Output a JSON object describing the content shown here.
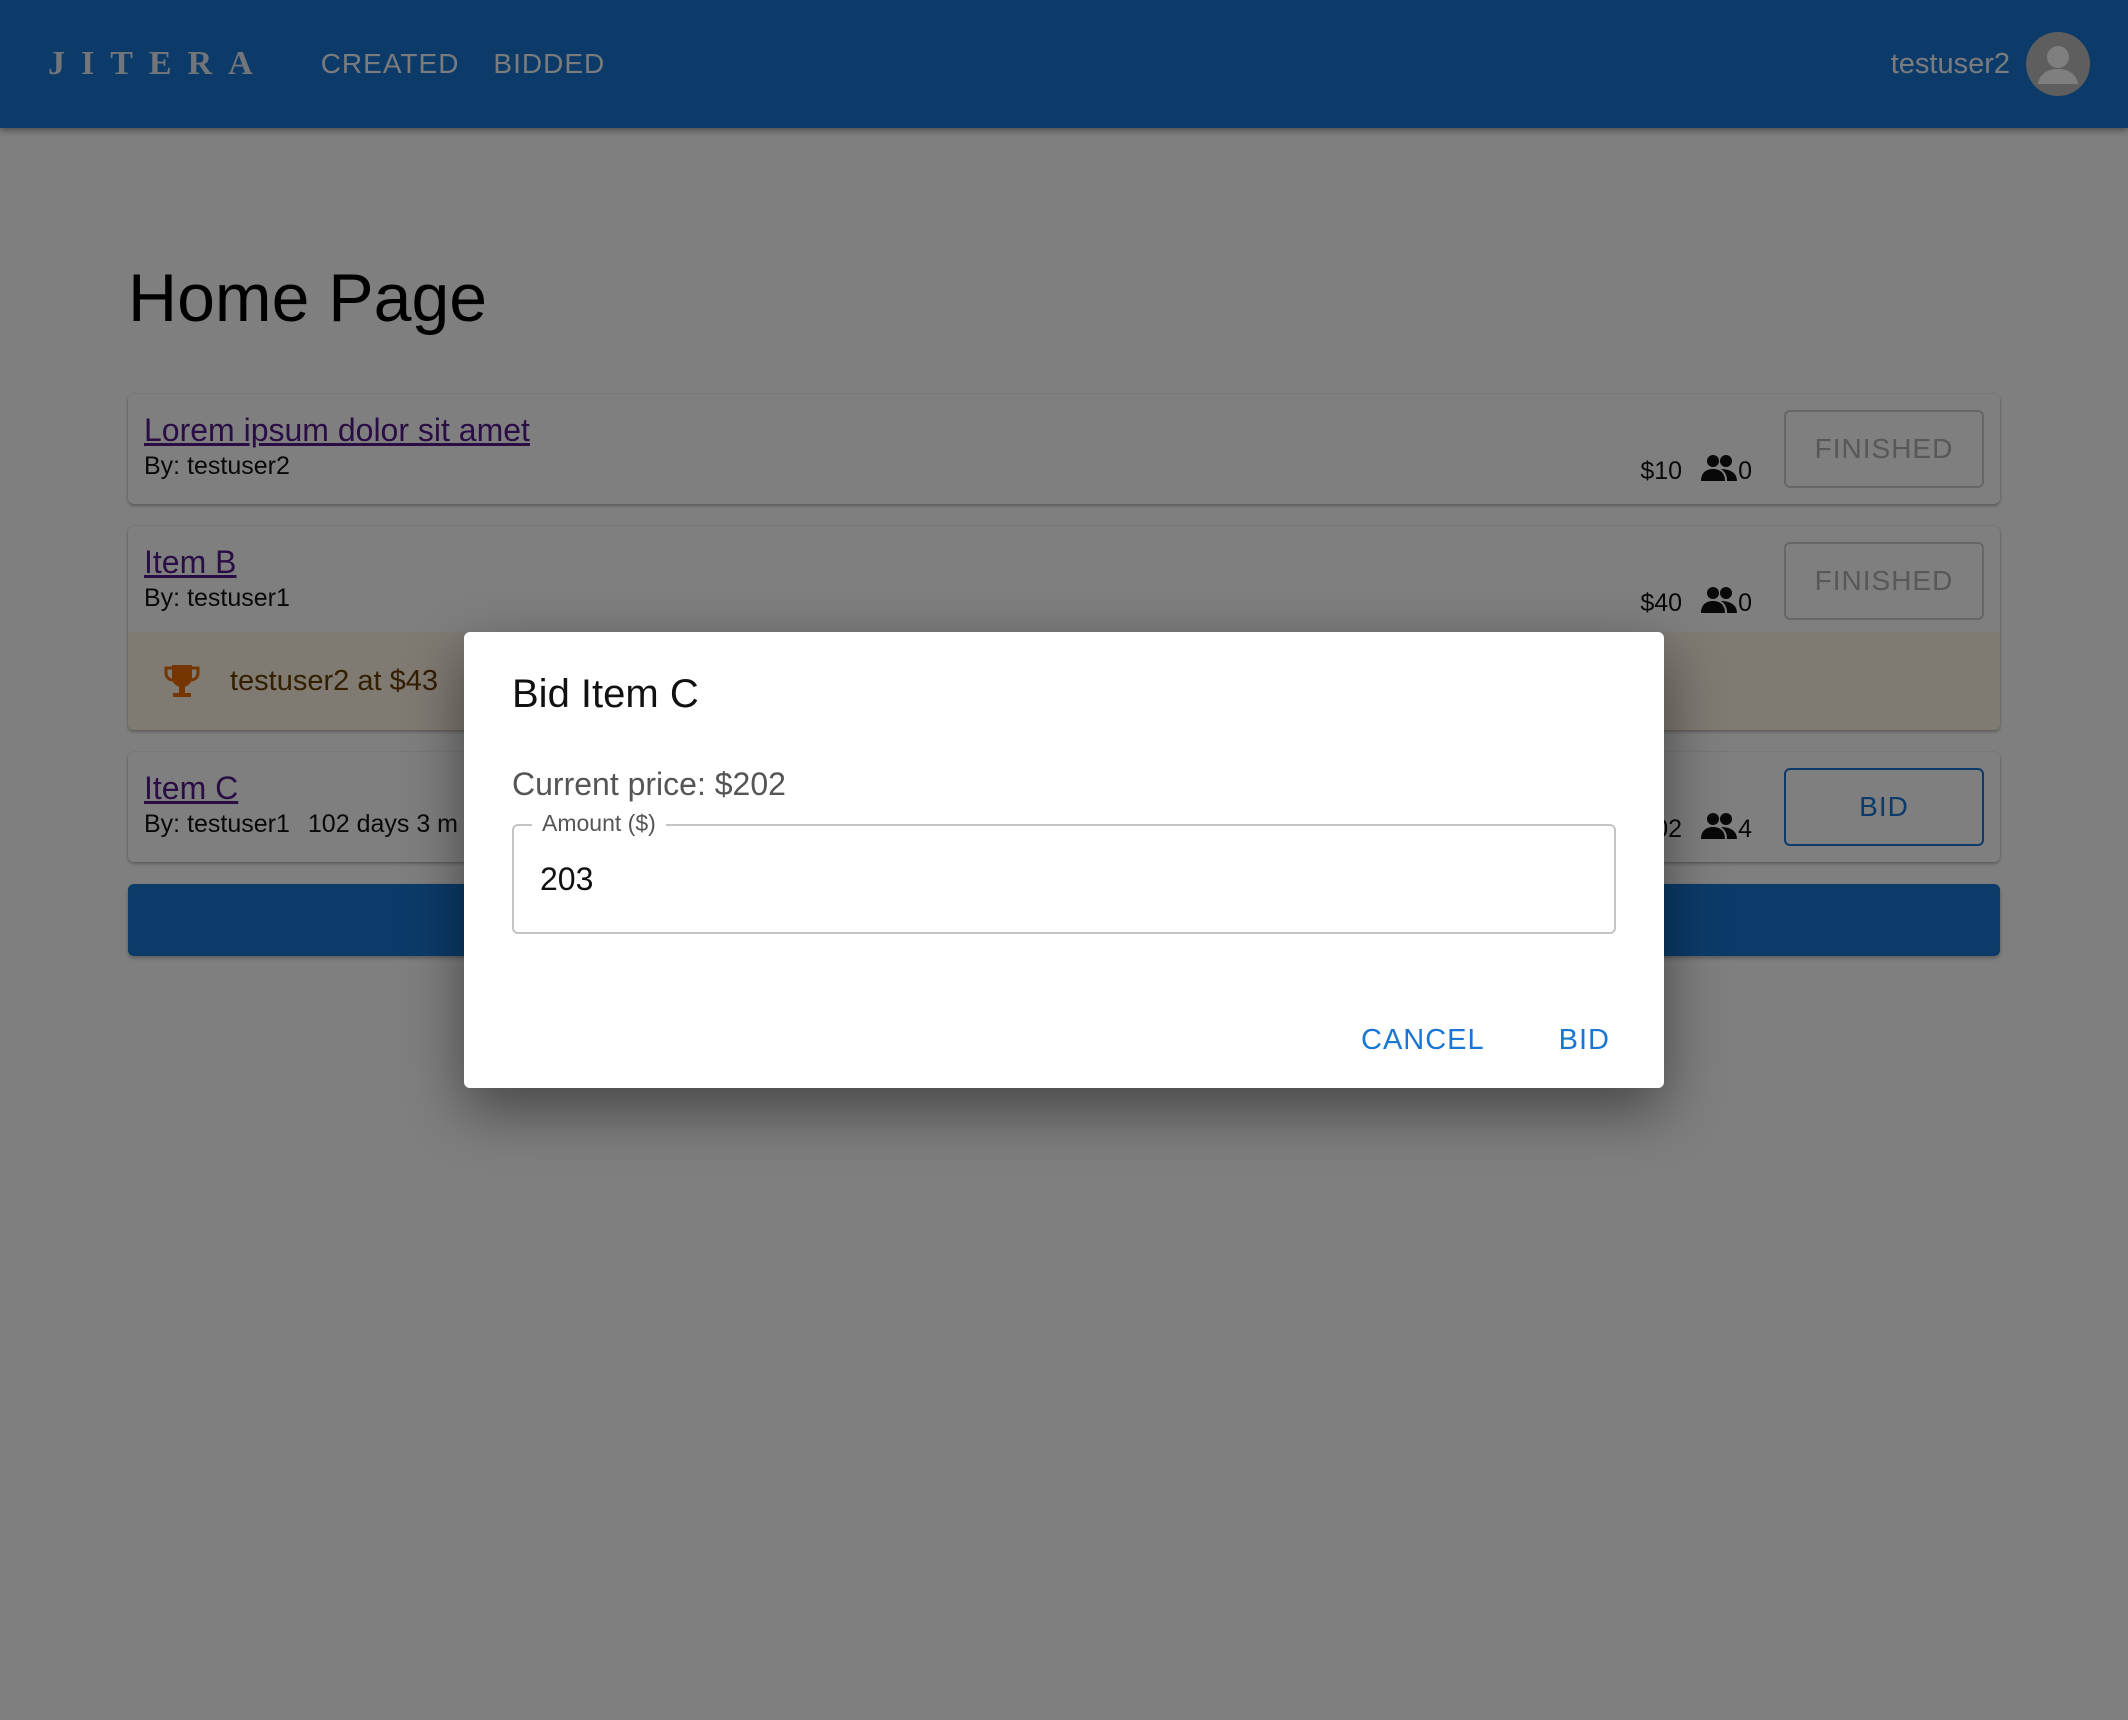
{
  "appbar": {
    "logo": "JITERA",
    "nav": [
      "CREATED",
      "BIDDED"
    ],
    "username": "testuser2",
    "avatar_icon": "account-circle-icon",
    "color": "#1976d2"
  },
  "main": {
    "title": "Home Page",
    "items": [
      {
        "name": "Lorem ipsum dolor sit amet",
        "by": "By: testuser2",
        "extra": "",
        "price": "$10",
        "bidders": "0",
        "status": "FINISHED"
      },
      {
        "name": "Item B",
        "by": "By: testuser1",
        "extra": "",
        "price": "$40",
        "bidders": "0",
        "status": "FINISHED",
        "winner": "testuser2 at $43"
      },
      {
        "name": "Item C",
        "by": "By: testuser1",
        "extra": "102 days 3 m",
        "price": "$202",
        "bidders": "4",
        "status": "BID"
      }
    ]
  },
  "dialog": {
    "title": "Bid Item C",
    "current_price": "Current price: $202",
    "amount_label": "Amount ($)",
    "amount_value": "203",
    "cancel_label": "CANCEL",
    "bid_label": "BID"
  }
}
